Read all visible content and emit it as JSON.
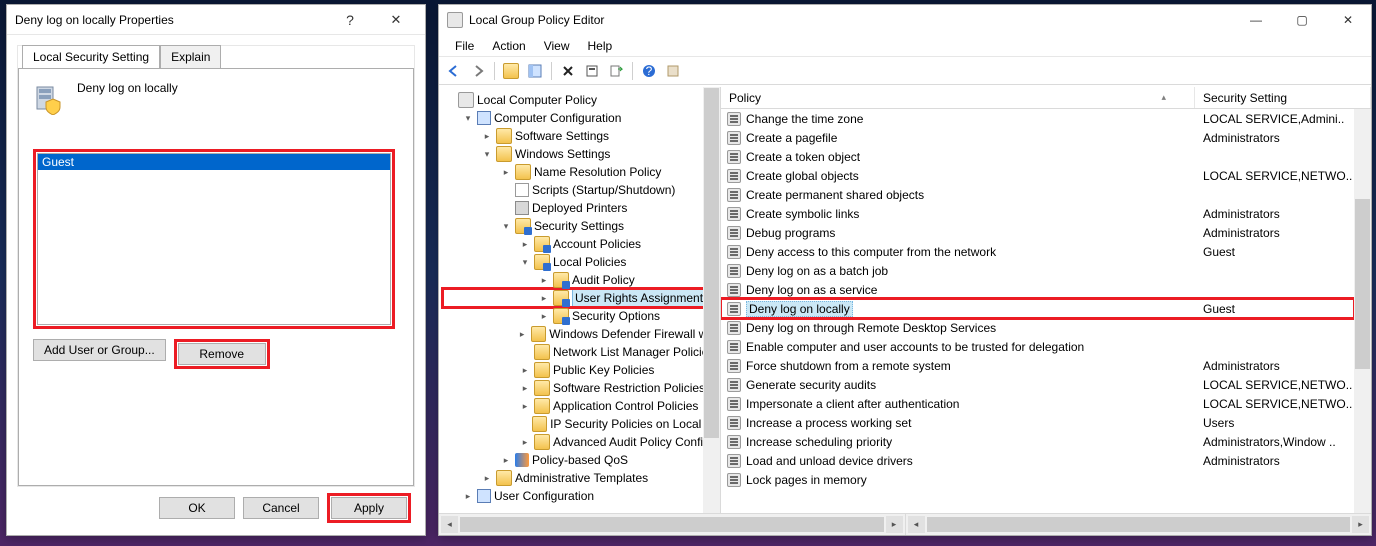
{
  "dialog": {
    "title": "Deny log on locally Properties",
    "tabs": [
      "Local Security Setting",
      "Explain"
    ],
    "heading": "Deny log on locally",
    "list_items": [
      "Guest"
    ],
    "add_button": "Add User or Group...",
    "remove_button": "Remove",
    "ok": "OK",
    "cancel": "Cancel",
    "apply": "Apply"
  },
  "window": {
    "title": "Local Group Policy Editor",
    "menus": [
      "File",
      "Action",
      "View",
      "Help"
    ],
    "tree": {
      "root": "Local Computer Policy",
      "cconf": "Computer Configuration",
      "sws": "Software Settings",
      "wset": "Windows Settings",
      "nrp": "Name Resolution Policy",
      "scripts": "Scripts (Startup/Shutdown)",
      "printers": "Deployed Printers",
      "secset": "Security Settings",
      "acct": "Account Policies",
      "local": "Local Policies",
      "audit": "Audit Policy",
      "ura": "User Rights Assignment",
      "secopt": "Security Options",
      "wdf": "Windows Defender Firewall with",
      "nlmp": "Network List Manager Policies",
      "pkp": "Public Key Policies",
      "srp": "Software Restriction Policies",
      "acp": "Application Control Policies",
      "ipsec": "IP Security Policies on Local Co",
      "aapc": "Advanced Audit Policy Configu",
      "qos": "Policy-based QoS",
      "atpl": "Administrative Templates",
      "uconf": "User Configuration"
    },
    "list": {
      "col_policy": "Policy",
      "col_sec": "Security Setting",
      "rows": [
        {
          "p": "Change the time zone",
          "s": "LOCAL SERVICE,Admini.."
        },
        {
          "p": "Create a pagefile",
          "s": "Administrators"
        },
        {
          "p": "Create a token object",
          "s": ""
        },
        {
          "p": "Create global objects",
          "s": "LOCAL SERVICE,NETWO.."
        },
        {
          "p": "Create permanent shared objects",
          "s": ""
        },
        {
          "p": "Create symbolic links",
          "s": "Administrators"
        },
        {
          "p": "Debug programs",
          "s": "Administrators"
        },
        {
          "p": "Deny access to this computer from the network",
          "s": "Guest"
        },
        {
          "p": "Deny log on as a batch job",
          "s": ""
        },
        {
          "p": "Deny log on as a service",
          "s": ""
        },
        {
          "p": "Deny log on locally",
          "s": "Guest",
          "selected": true,
          "highlight": true
        },
        {
          "p": "Deny log on through Remote Desktop Services",
          "s": ""
        },
        {
          "p": "Enable computer and user accounts to be trusted for delegation",
          "s": ""
        },
        {
          "p": "Force shutdown from a remote system",
          "s": "Administrators"
        },
        {
          "p": "Generate security audits",
          "s": "LOCAL SERVICE,NETWO.."
        },
        {
          "p": "Impersonate a client after authentication",
          "s": "LOCAL SERVICE,NETWO.."
        },
        {
          "p": "Increase a process working set",
          "s": "Users"
        },
        {
          "p": "Increase scheduling priority",
          "s": "Administrators,Window .."
        },
        {
          "p": "Load and unload device drivers",
          "s": "Administrators"
        },
        {
          "p": "Lock pages in memory",
          "s": ""
        }
      ]
    }
  }
}
